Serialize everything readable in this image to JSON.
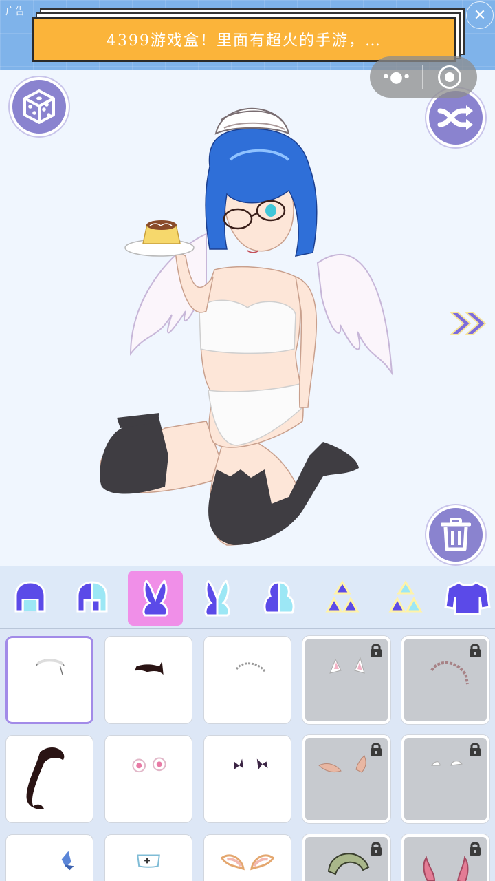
{
  "ad": {
    "tag": "广告",
    "text": "4399游戏盒！里面有超火的手游，…",
    "close_icon": "close-icon"
  },
  "capsule": {
    "more_icon": "more-dots-icon",
    "close_icon": "target-icon"
  },
  "stage": {
    "buttons": [
      "dice-icon",
      "shuffle-icon",
      "trash-icon",
      "double-chevron-right-icon"
    ]
  },
  "categories": [
    {
      "name": "hair-front-icon",
      "active": false
    },
    {
      "name": "hair-back-icon",
      "active": false
    },
    {
      "name": "bunny-ears-icon",
      "active": true
    },
    {
      "name": "bunny-ears-alt-icon",
      "active": false
    },
    {
      "name": "half-hair-icon",
      "active": false
    },
    {
      "name": "triangle-cluster-icon",
      "active": false
    },
    {
      "name": "triangle-cluster-alt-icon",
      "active": false
    },
    {
      "name": "sweater-icon",
      "active": false
    }
  ],
  "items": [
    {
      "name": "maid-headband",
      "locked": false,
      "selected": true
    },
    {
      "name": "black-cat-ears",
      "locked": false,
      "selected": false
    },
    {
      "name": "lace-headband",
      "locked": false,
      "selected": false
    },
    {
      "name": "white-cat-ears",
      "locked": true,
      "selected": false
    },
    {
      "name": "frilled-headband",
      "locked": true,
      "selected": false
    },
    {
      "name": "black-antenna",
      "locked": false,
      "selected": false
    },
    {
      "name": "pink-fluffy-ears",
      "locked": false,
      "selected": false
    },
    {
      "name": "purple-bows",
      "locked": false,
      "selected": false
    },
    {
      "name": "elf-ears",
      "locked": true,
      "selected": false
    },
    {
      "name": "small-wings",
      "locked": true,
      "selected": false
    },
    {
      "name": "blue-bow",
      "locked": false,
      "selected": false
    },
    {
      "name": "nurse-cap",
      "locked": false,
      "selected": false
    },
    {
      "name": "fox-ears",
      "locked": false,
      "selected": false
    },
    {
      "name": "green-headdress",
      "locked": true,
      "selected": false
    },
    {
      "name": "pink-horns",
      "locked": true,
      "selected": false
    }
  ],
  "colors": {
    "accent": "#8a83cf",
    "active_tab": "#f08fe8",
    "icon_primary": "#5b4ae8",
    "icon_secondary": "#9ce7f5",
    "ad_orange": "#fbb43a",
    "hair_blue": "#2f6fd8"
  }
}
